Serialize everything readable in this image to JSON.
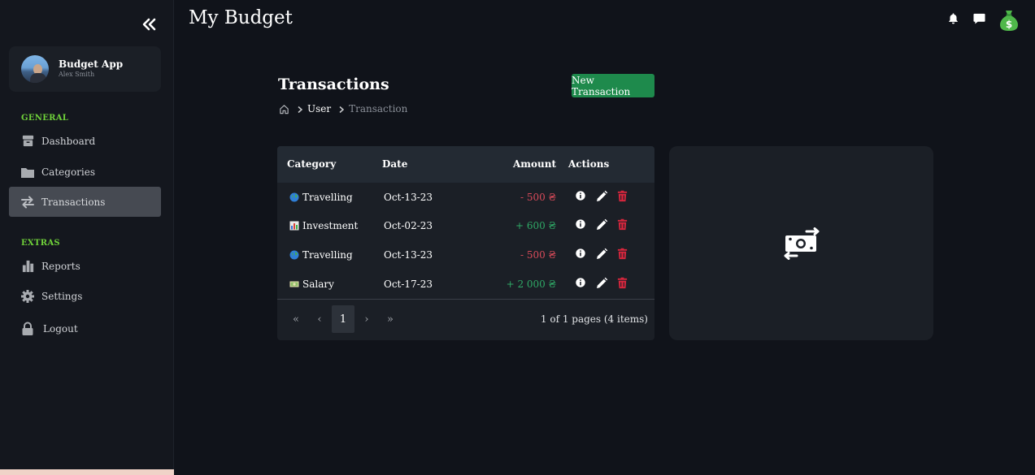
{
  "app": {
    "title": "My Budget"
  },
  "sidebar": {
    "profile": {
      "name": "Budget App",
      "subtitle": "Alex Smith"
    },
    "sections": [
      {
        "label": "GENERAL"
      },
      {
        "label": "EXTRAS"
      }
    ],
    "items": [
      {
        "label": "Dashboard",
        "icon": "box-icon"
      },
      {
        "label": "Categories",
        "icon": "folder-icon"
      },
      {
        "label": "Transactions",
        "icon": "swap-arrows-icon",
        "active": true
      },
      {
        "label": "Reports",
        "icon": "bar-chart-icon"
      },
      {
        "label": "Settings",
        "icon": "gear-icon"
      },
      {
        "label": "Logout",
        "icon": "lock-icon"
      }
    ]
  },
  "header": {
    "page_title": "Transactions",
    "new_button": "New Transaction",
    "breadcrumb": {
      "user": "User",
      "current": "Transaction"
    }
  },
  "table": {
    "columns": {
      "category": "Category",
      "date": "Date",
      "amount": "Amount",
      "actions": "Actions"
    },
    "rows": [
      {
        "category": "Travelling",
        "icon": "globe-icon",
        "date": "Oct-13-23",
        "amount": "- 500 ₴",
        "type": "expense"
      },
      {
        "category": "Investment",
        "icon": "chart-icon",
        "date": "Oct-02-23",
        "amount": "+ 600 ₴",
        "type": "income"
      },
      {
        "category": "Travelling",
        "icon": "globe-icon",
        "date": "Oct-13-23",
        "amount": "- 500 ₴",
        "type": "expense"
      },
      {
        "category": "Salary",
        "icon": "cash-icon",
        "date": "Oct-17-23",
        "amount": "+ 2 000 ₴",
        "type": "income"
      }
    ],
    "pagination": {
      "first": "«",
      "prev": "‹",
      "current_page": "1",
      "next": "›",
      "last": "»",
      "info": "1 of 1 pages (4 items)"
    }
  },
  "colors": {
    "accent_green": "#6fd13a",
    "button_green": "#1e8a4c",
    "negative": "#d94b5a",
    "positive": "#2fa866",
    "delete_red": "#d7263d"
  }
}
